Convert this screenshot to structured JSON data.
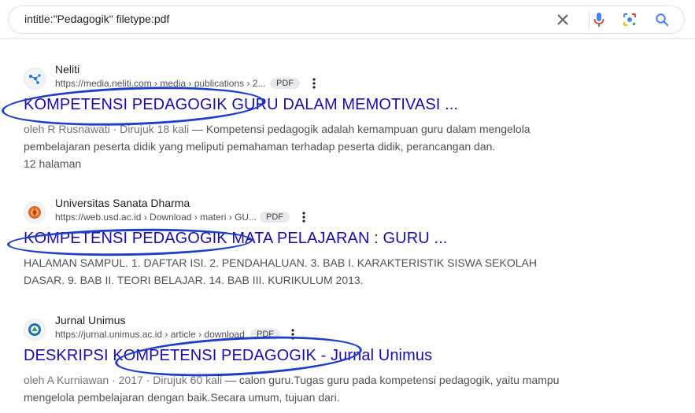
{
  "search": {
    "query": "intitle:\"Pedagogik\" filetype:pdf"
  },
  "icons": {
    "clear": "close-icon",
    "voice": "microphone-icon",
    "lens": "lens-icon",
    "search": "search-icon"
  },
  "colors": {
    "title_link": "#1a0dab",
    "annotation": "#1e3fc9"
  },
  "results": [
    {
      "site_name": "Neliti",
      "url": "https://media.neliti.com › media › publications › 2...",
      "badge": "PDF",
      "title": "KOMPETENSI PEDAGOGIK GURU DALAM MEMOTIVASI ...",
      "meta": "oleh R Rusnawati · Dirujuk 18 kali",
      "snippet": " — Kompetensi pedagogik adalah kemampuan guru dalam mengelola pembelajaran peserta didik yang meliputi pemahaman terhadap peserta didik, perancangan dan.",
      "extra": "12 halaman"
    },
    {
      "site_name": "Universitas Sanata Dharma",
      "url": "https://web.usd.ac.id › Download › materi › GU...",
      "badge": "PDF",
      "title": "KOMPETENSI PEDAGOGIK MATA PELAJARAN : GURU ...",
      "snippet": "HALAMAN SAMPUL. 1. DAFTAR ISI. 2. PENDAHALUAN. 3. BAB I. KARAKTERISTIK SISWA SEKOLAH DASAR. 9. BAB II. TEORI BELAJAR. 14. BAB III. KURIKULUM 2013."
    },
    {
      "site_name": "Jurnal Unimus",
      "url": "https://jurnal.unimus.ac.id › article › download",
      "badge": "PDF",
      "title": "DESKRIPSI KOMPETENSI PEDAGOGIK - Jurnal Unimus",
      "meta": "oleh A Kurniawan · 2017 · Dirujuk 60 kali",
      "snippet": " — calon guru.Tugas guru pada kompetensi pedagogik, yaitu mampu mengelola pembelajaran dengan baik.Secara umum, tujuan dari."
    }
  ]
}
